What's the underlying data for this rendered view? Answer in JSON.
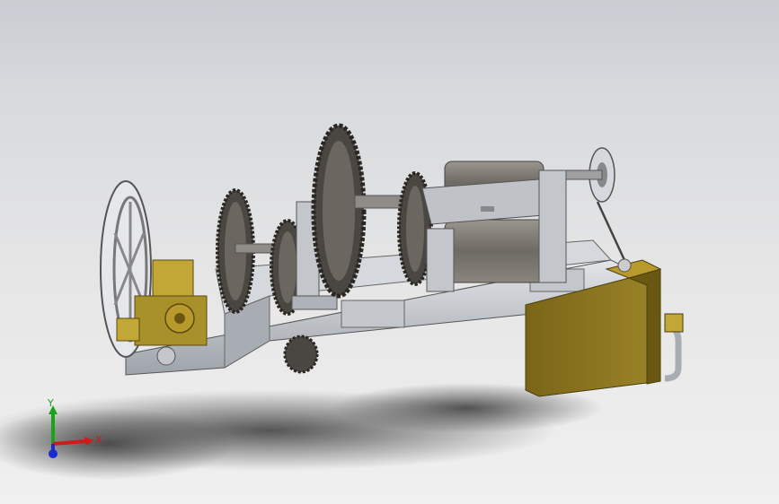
{
  "viewport": {
    "background_top": "#c9ccd2",
    "background_bottom": "#f0f0f0"
  },
  "model": {
    "base_color": "#c7cbd0",
    "gear_color": "#4a4642",
    "motor_color": "#7a7670",
    "tank_color": "#8a7420",
    "brass_color": "#b89a2c"
  },
  "triad": {
    "x_label": "X",
    "y_label": "Y",
    "x_color": "#d11a1a",
    "y_color": "#1aa31a",
    "z_color": "#1a2ad1"
  }
}
